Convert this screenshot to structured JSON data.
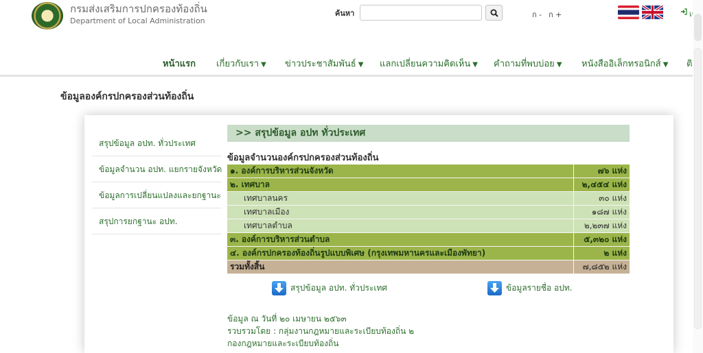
{
  "header": {
    "org_name_th": "กรมส่งเสริมการปกครองท้องถิ่น",
    "org_name_en": "Department of Local Administration",
    "search_label": "ค้นหา",
    "search_value": "",
    "font_small": "ก -",
    "font_large": "ก +",
    "login_label": "เข"
  },
  "nav": {
    "items": [
      {
        "label": "หน้าแรก"
      },
      {
        "label": "เกี่ยวกับเรา"
      },
      {
        "label": "ข่าวประชาสัมพันธ์"
      },
      {
        "label": "แลกเปลี่ยนความคิดเห็น"
      },
      {
        "label": "คำถามที่พบบ่อย"
      },
      {
        "label": "หนังสืออิเล็กทรอนิกส์"
      },
      {
        "label": "ติ"
      }
    ]
  },
  "page": {
    "heading": "ข้อมูลองค์กรปกครองส่วนท้องถิ่น"
  },
  "sidebar": {
    "items": [
      {
        "label": "สรุปข้อมูล อปท. ทั่วประเทศ"
      },
      {
        "label": "ข้อมูลจำนวน อปท. แยกรายจังหวัด"
      },
      {
        "label": "ข้อมูลการเปลี่ยนแปลงและยกฐานะ"
      },
      {
        "label": "สรุปการยกฐานะ อปท."
      }
    ]
  },
  "main": {
    "section_title": ">> สรุปข้อมูล อปท ทั่วประเทศ",
    "table_title": "ข้อมูลจำนวนองค์กรปกครองส่วนท้องถิ่น",
    "rows": [
      {
        "label": "๑. องค์การบริหารส่วนจังหวัด",
        "value": "๗๖ แห่ง",
        "kind": "main"
      },
      {
        "label": "๒. เทศบาล",
        "value": "๒,๔๕๔ แห่ง",
        "kind": "main"
      },
      {
        "label": "เทศบาลนคร",
        "value": "๓๐ แห่ง",
        "kind": "sub"
      },
      {
        "label": "เทศบาลเมือง",
        "value": "๑๘๗ แห่ง",
        "kind": "sub"
      },
      {
        "label": "เทศบาลตำบล",
        "value": "๒,๒๓๗ แห่ง",
        "kind": "sub"
      },
      {
        "label": "๓. องค์การบริหารส่วนตำบล",
        "value": "๕,๓๒๐ แห่ง",
        "kind": "main"
      },
      {
        "label": "๔. องค์กรปกครองท้องถิ่นรูปแบบพิเศษ (กรุงเทพมหานครและเมืองพัทยา)",
        "value": "๒ แห่ง",
        "kind": "main"
      },
      {
        "label": "รวมทั้งสิ้น",
        "value": "๗,๘๕๒ แห่ง",
        "kind": "total"
      }
    ],
    "download_summary": "สรุปข้อมูล อปท. ทั่วประเทศ",
    "download_list": "ข้อมูลรายชื่อ อปท.",
    "footer": {
      "date_line": "ข้อมูล ณ วันที่ ๒๐ เมษายน ๒๕๖๓",
      "compiled_by": "รวบรวมโดย : กลุ่มงานกฎหมายและระเบียบท้องถิ่น ๒",
      "division": "กองกฎหมายและระเบียบท้องถิ่น"
    }
  },
  "colors": {
    "brand_green": "#2c6f2c",
    "main_row": "#9cb54a",
    "sub_row": "#cde2b6",
    "total_row": "#c6b196",
    "title_bar": "#c9ddc8"
  }
}
